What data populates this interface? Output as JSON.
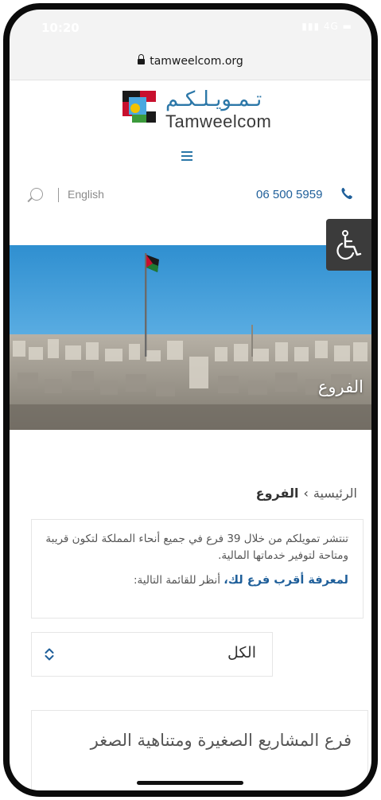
{
  "status_bar": {
    "time": "10:20",
    "network": "4G"
  },
  "browser": {
    "url": "tamweelcom.org"
  },
  "header": {
    "logo_arabic": "تـمـويـلـكـم",
    "logo_english": "Tamweelcom",
    "language_link": "English",
    "phone_number": "06 500 5959"
  },
  "hero": {
    "title": "الفروع"
  },
  "breadcrumb": {
    "home": "الرئيسية",
    "current": "الفروع"
  },
  "intro": {
    "text": "تنتشر تمويلكم من خلال 39 فرع في جميع أنحاء المملكة لتكون قريبة ومتاحة لتوفير خدماتها المالية.",
    "cta_link": "لمعرفة أقرب فرع لك،",
    "cta_rest": " أنظر للقائمة التالية:"
  },
  "filter": {
    "selected": "الكل"
  },
  "branch": {
    "title": "فرع المشاريع الصغيرة ومتناهية الصغر"
  },
  "colors": {
    "brand_blue": "#2b77a8",
    "link_blue": "#1f5f9a",
    "accessibility_bg": "#3b3b3b"
  }
}
